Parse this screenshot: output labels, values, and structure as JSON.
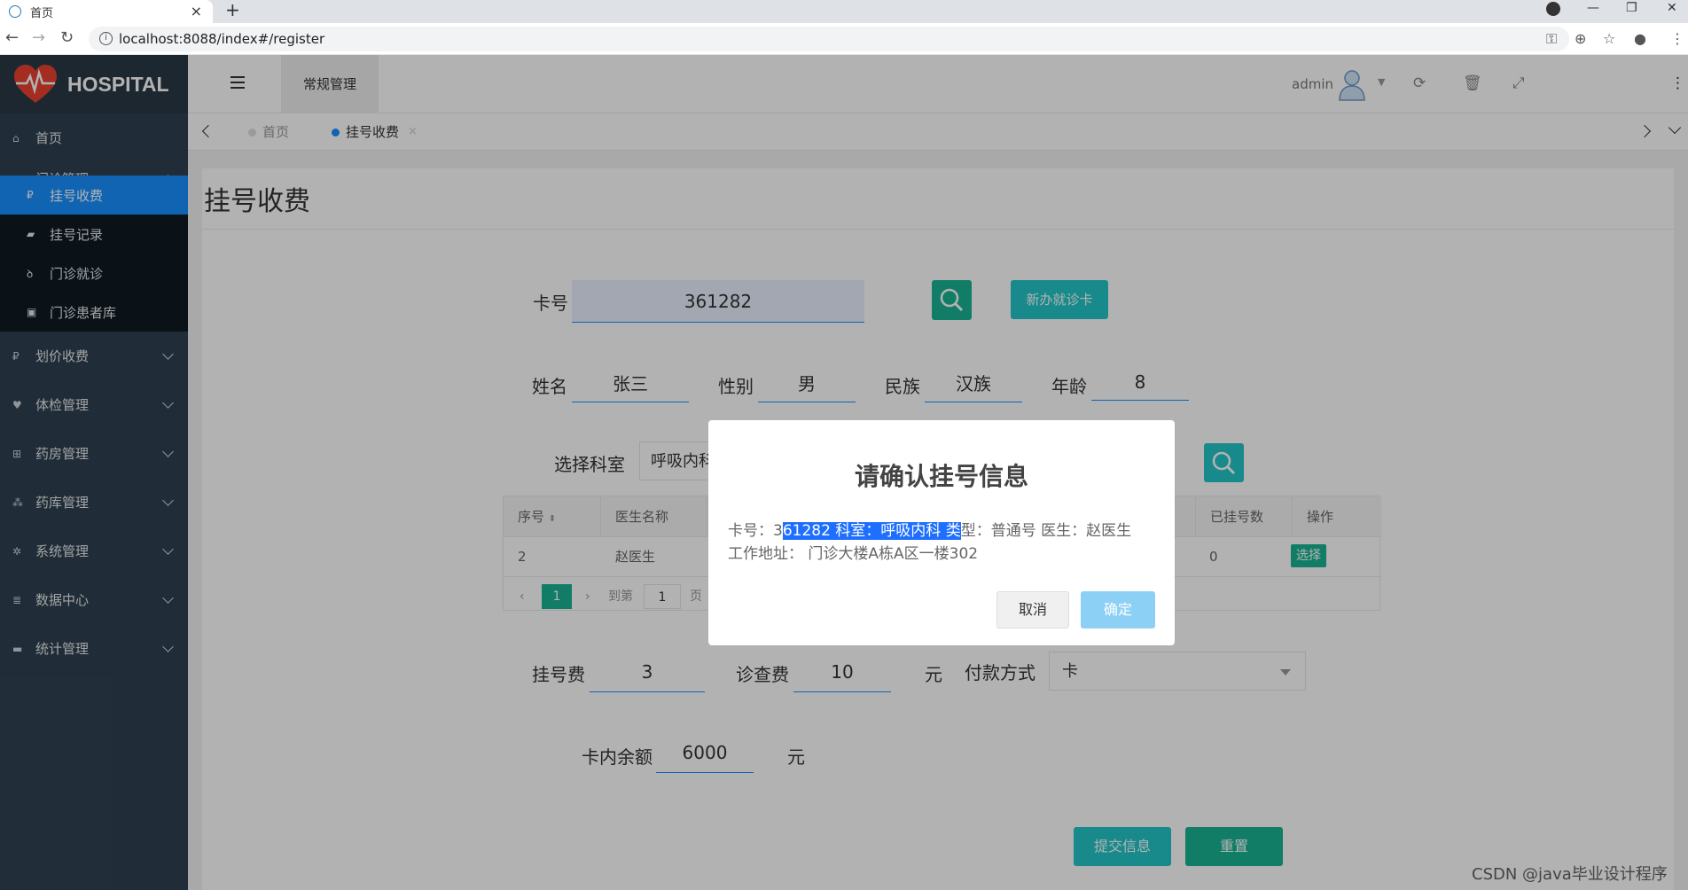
{
  "browser": {
    "tab_title": "首页",
    "url": "localhost:8088/index#/register"
  },
  "sidebar": {
    "logo_text": "HOSPITAL",
    "items": [
      {
        "label": "首页",
        "icon": "home-icon"
      },
      {
        "label": "门诊管理",
        "icon": "clipboard-icon"
      },
      {
        "label": "划价收费",
        "icon": "paypal-icon"
      },
      {
        "label": "体检管理",
        "icon": "heartbeat-icon"
      },
      {
        "label": "药房管理",
        "icon": "plus-square-icon"
      },
      {
        "label": "药库管理",
        "icon": "cubes-icon"
      },
      {
        "label": "系统管理",
        "icon": "gear-icon"
      },
      {
        "label": "数据中心",
        "icon": "database-icon"
      },
      {
        "label": "统计管理",
        "icon": "comment-icon"
      }
    ],
    "submenu": [
      {
        "label": "挂号收费",
        "icon": "paypal-icon"
      },
      {
        "label": "挂号记录",
        "icon": "book-icon"
      },
      {
        "label": "门诊就诊",
        "icon": "stethoscope-icon"
      },
      {
        "label": "门诊患者库",
        "icon": "contact-card-icon"
      }
    ]
  },
  "header": {
    "top_nav": "常规管理",
    "username": "admin"
  },
  "page_tabs": [
    {
      "label": "首页"
    },
    {
      "label": "挂号收费"
    }
  ],
  "form": {
    "page_title": "挂号收费",
    "card_label": "卡号",
    "card_value": "361282",
    "new_card_button": "新办就诊卡",
    "name_label": "姓名",
    "name_value": "张三",
    "gender_label": "性别",
    "gender_value": "男",
    "ethnicity_label": "民族",
    "ethnicity_value": "汉族",
    "age_label": "年龄",
    "age_value": "8",
    "dept_label": "选择科室",
    "dept_value": "呼吸内科",
    "reg_fee_label": "挂号费",
    "reg_fee_value": "3",
    "exam_fee_label": "诊查费",
    "exam_fee_value": "10",
    "yuan": "元",
    "pay_label": "付款方式",
    "pay_value": "卡",
    "balance_label": "卡内余额",
    "balance_value": "6000",
    "submit_button": "提交信息",
    "reset_button": "重置"
  },
  "table": {
    "headers": [
      "序号",
      "医生名称",
      "已挂号数",
      "操作"
    ],
    "rows": [
      {
        "index": "2",
        "doctor": "赵医生",
        "count": "0",
        "action": "选择"
      }
    ],
    "pager": {
      "current": "1",
      "goto_label": "到第",
      "goto_value": "1",
      "page_suffix": "页"
    }
  },
  "dialog": {
    "title": "请确认挂号信息",
    "line1_pre": "卡号：3",
    "line1_highlight": "61282 科室：呼吸内科 类",
    "line1_post": "型：普通号 医生：赵医生",
    "line2": "工作地址： 门诊大楼A栋A区一楼302",
    "cancel": "取消",
    "confirm": "确定"
  },
  "watermark": "CSDN @java毕业设计程序",
  "colors": {
    "sidebar_bg": "#2f4050",
    "active_menu": "#1890ff",
    "primary_green": "#1ab394",
    "info_cyan": "#23c6c8",
    "highlight": "#1e6fff"
  }
}
